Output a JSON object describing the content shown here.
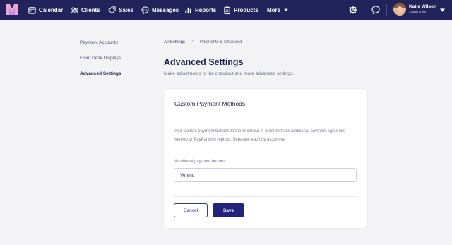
{
  "nav": {
    "items": [
      {
        "label": "Calendar",
        "icon": "calendar-icon"
      },
      {
        "label": "Clients",
        "icon": "clients-icon"
      },
      {
        "label": "Sales",
        "icon": "tag-icon"
      },
      {
        "label": "Messages",
        "icon": "message-bubble-icon"
      },
      {
        "label": "Reports",
        "icon": "bar-chart-icon"
      },
      {
        "label": "Products",
        "icon": "clipboard-icon"
      }
    ],
    "more_label": "More",
    "settings_icon": "gear-icon",
    "chat_icon": "chat-icon",
    "user": {
      "name": "Katie Wilson",
      "salon": "Salon Azul"
    }
  },
  "sidebar": {
    "items": [
      {
        "label": "Payment Accounts",
        "active": false
      },
      {
        "label": "Front Desk Displays",
        "active": false
      },
      {
        "label": "Advanced Settings",
        "active": true
      }
    ]
  },
  "breadcrumb": {
    "parent": "All Settings",
    "separator": ">",
    "current": "Payments & Checkout"
  },
  "page": {
    "title": "Advanced Settings",
    "subtitle": "Make adjustments to the checkout and more advanced settings."
  },
  "card": {
    "title": "Custom Payment Methods",
    "description": "Add custom payment buttons to the checkout in order to track additional payment types like Venmo or PayPal with reports. Separate each by a comma.",
    "field_label": "Additional payment buttons",
    "field_value": "Venmo",
    "cancel_label": "Cancel",
    "save_label": "Save"
  },
  "colors": {
    "nav_bg": "#22235a",
    "accent": "#22237a",
    "page_bg": "#f3f3f5"
  }
}
